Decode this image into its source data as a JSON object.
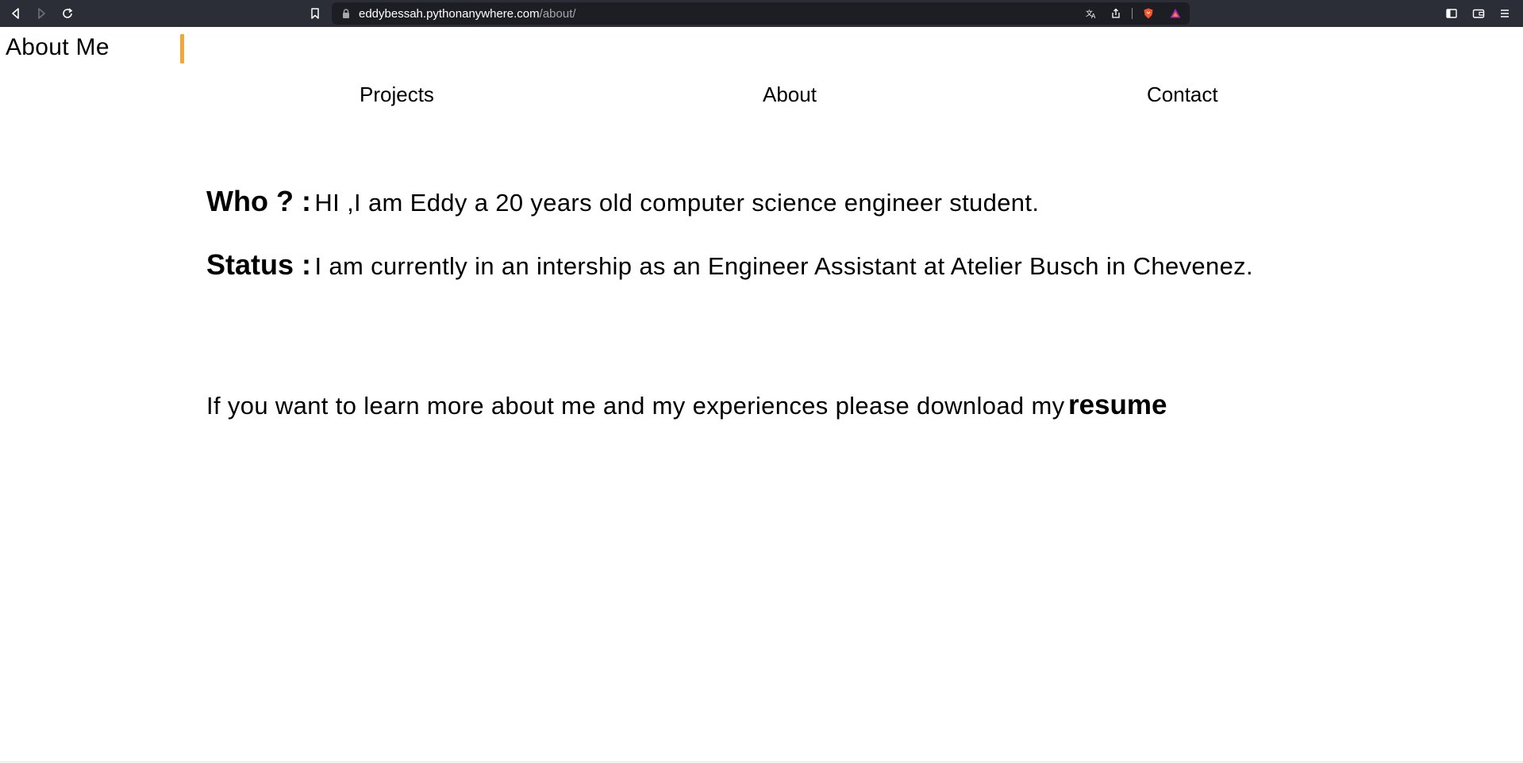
{
  "browser": {
    "url_host": "eddybessah.pythonanywhere.com",
    "url_path": "/about/",
    "icons": [
      "back-icon",
      "forward-icon",
      "reload-icon",
      "bookmark-icon",
      "lock-icon",
      "translate-icon",
      "share-icon",
      "brave-shield-icon",
      "brave-rewards-icon",
      "sidebar-icon",
      "wallet-icon",
      "menu-icon"
    ]
  },
  "header": {
    "title": "About Me",
    "accent_color": "#f3a73b"
  },
  "nav": {
    "items": [
      {
        "label": "Projects"
      },
      {
        "label": "About"
      },
      {
        "label": "Contact"
      }
    ]
  },
  "main": {
    "who_label": "Who ? :",
    "who_text": "HI ,I am Eddy a 20 years old computer science engineer student.",
    "status_label": "Status :",
    "status_text": "I am currently in an intership as an Engineer Assistant at Atelier Busch in Chevenez.",
    "resume_prompt": "If you want to learn more about me and my experiences please download my",
    "resume_link": "resume"
  }
}
